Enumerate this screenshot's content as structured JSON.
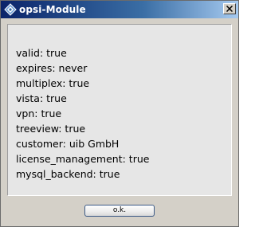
{
  "window": {
    "title": "opsi-Module",
    "icon": "opsi-diamond-icon",
    "close_icon": "close-x-icon"
  },
  "modules": [
    "valid: true",
    "expires: never",
    "multiplex: true",
    "vista: true",
    "vpn: true",
    "treeview: true",
    "customer: uib GmbH",
    "license_management: true",
    "mysql_backend: true"
  ],
  "buttons": {
    "ok_label": "o.k."
  },
  "colors": {
    "title_bar_start": "#0a246a",
    "title_bar_end": "#a6caf0",
    "window_bg": "#d4d0c8",
    "panel_bg": "#e6e6e6"
  }
}
